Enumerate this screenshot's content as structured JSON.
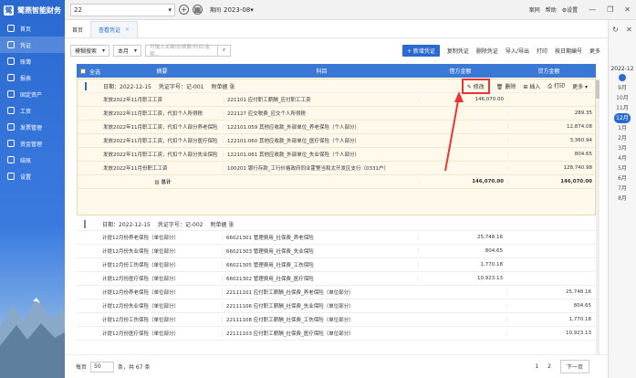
{
  "app": {
    "name": "鹭燕智能财务",
    "account": "22",
    "period_label": "期间",
    "period": "2023-08"
  },
  "top_links": [
    "案同",
    "帮助",
    "设置"
  ],
  "sidebar": {
    "items": [
      {
        "label": "首页"
      },
      {
        "label": "凭证"
      },
      {
        "label": "账簿"
      },
      {
        "label": "报表"
      },
      {
        "label": "固定资产"
      },
      {
        "label": "工资"
      },
      {
        "label": "发票管理"
      },
      {
        "label": "资金管理"
      },
      {
        "label": "结账"
      },
      {
        "label": "设置"
      }
    ]
  },
  "tabs": [
    {
      "label": "首页"
    },
    {
      "label": "查看凭证"
    }
  ],
  "toolbar": {
    "filter": "模糊搜索",
    "period": "本月",
    "search_placeholder": "可输入关键词/摘要/科目/金额...",
    "new": "+ 新增凭证",
    "copy": "复制凭证",
    "delete": "删除凭证",
    "import": "导入/导出",
    "print": "打印",
    "renumber": "按日期编号",
    "more": "更多"
  },
  "table_header": {
    "select_all": "全选",
    "summary": "摘要",
    "subject": "科目",
    "debit": "借方金额",
    "credit": "贷方金额"
  },
  "voucher1": {
    "date": "日期：2022-12-15",
    "no": "凭证字号：记-001",
    "attach": "附单据 张",
    "actions": {
      "edit": "修改",
      "delete": "删除",
      "insert": "插入",
      "print": "打印",
      "more": "更多"
    },
    "rows": [
      {
        "summary": "发放2022年11月职工工资",
        "subject": "221101 应付职工薪酬_应付职工工资",
        "debit": "146,070.00",
        "credit": ""
      },
      {
        "summary": "发放2022年11月职工工资，代扣个人所得税",
        "subject": "222127 应交税费_应交个人所得税",
        "debit": "",
        "credit": "289.35"
      },
      {
        "summary": "发放2022年11月职工工资，代扣个人部分养老保险",
        "subject": "122101.059 其他应收款_外部单位_养老保险（个人部分）",
        "debit": "",
        "credit": "12,874.08"
      },
      {
        "summary": "发放2022年11月职工工资，代扣个人部分医疗保险",
        "subject": "122101.060 其他应收款_外部单位_医疗保险（个人部分）",
        "debit": "",
        "credit": "3,360.94"
      },
      {
        "summary": "发放2022年11月职工工资，代扣个人部分失业保险",
        "subject": "122101.061 其他应收款_外部单位_失业保险（个人部分）",
        "debit": "",
        "credit": "804.65"
      },
      {
        "summary": "发放2022年11月份职工工资",
        "subject": "100201 银行存款_工行价格政府同业霍警当和太开发区支行（0331户）",
        "debit": "",
        "credit": "128,740.98"
      }
    ],
    "total_label": "总计",
    "total_debit": "146,070.00",
    "total_credit": "146,070.00"
  },
  "voucher2": {
    "date": "日期：2022-12-15",
    "no": "凭证字号：记-002",
    "attach": "附单据 张",
    "rows": [
      {
        "summary": "计提12月份养老保险（单位部分）",
        "subject": "66021301 管理费用_社保费_养老保险",
        "debit": "25,748.16",
        "credit": ""
      },
      {
        "summary": "计提12月份失业保险（单位部分）",
        "subject": "66021303 管理费用_社保费_失业保险",
        "debit": "804.65",
        "credit": ""
      },
      {
        "summary": "计提12月份工伤保险（单位部分）",
        "subject": "66021305 管理费用_社保费_工伤保险",
        "debit": "1,770.18",
        "credit": ""
      },
      {
        "summary": "计提12月份医疗保险（单位部分）",
        "subject": "66021302 管理费用_社保费_医疗保险",
        "debit": "10,923.13",
        "credit": ""
      },
      {
        "summary": "计提12月份养老保险（单位部分）",
        "subject": "22111101 应付职工薪酬_社保费_养老保险（单位部分）",
        "debit": "",
        "credit": "25,748.16"
      },
      {
        "summary": "计提12月份失业保险（单位部分）",
        "subject": "22111106 应付职工薪酬_社保费_失业保险（单位部分）",
        "debit": "",
        "credit": "804.65"
      },
      {
        "summary": "计提12月份工伤保险（单位部分）",
        "subject": "22111108 应付职工薪酬_社保费_工伤保险（单位部分）",
        "debit": "",
        "credit": "1,770.18"
      },
      {
        "summary": "计提12月份医疗保险（单位部分）",
        "subject": "22111103 应付职工薪酬_社保费_医疗保险（单位部分）",
        "debit": "",
        "credit": "10,923.13"
      }
    ]
  },
  "right_panel": {
    "year": "2022-12",
    "months": [
      "9月",
      "10月",
      "11月",
      "12月",
      "1月",
      "2月",
      "3月",
      "4月",
      "5月",
      "6月",
      "7月",
      "8月"
    ],
    "selected": "12月"
  },
  "pager": {
    "per_page": "每页",
    "size": "50",
    "count": "条，共 67 条",
    "p1": "1",
    "p2": "2",
    "next": "下一页"
  }
}
